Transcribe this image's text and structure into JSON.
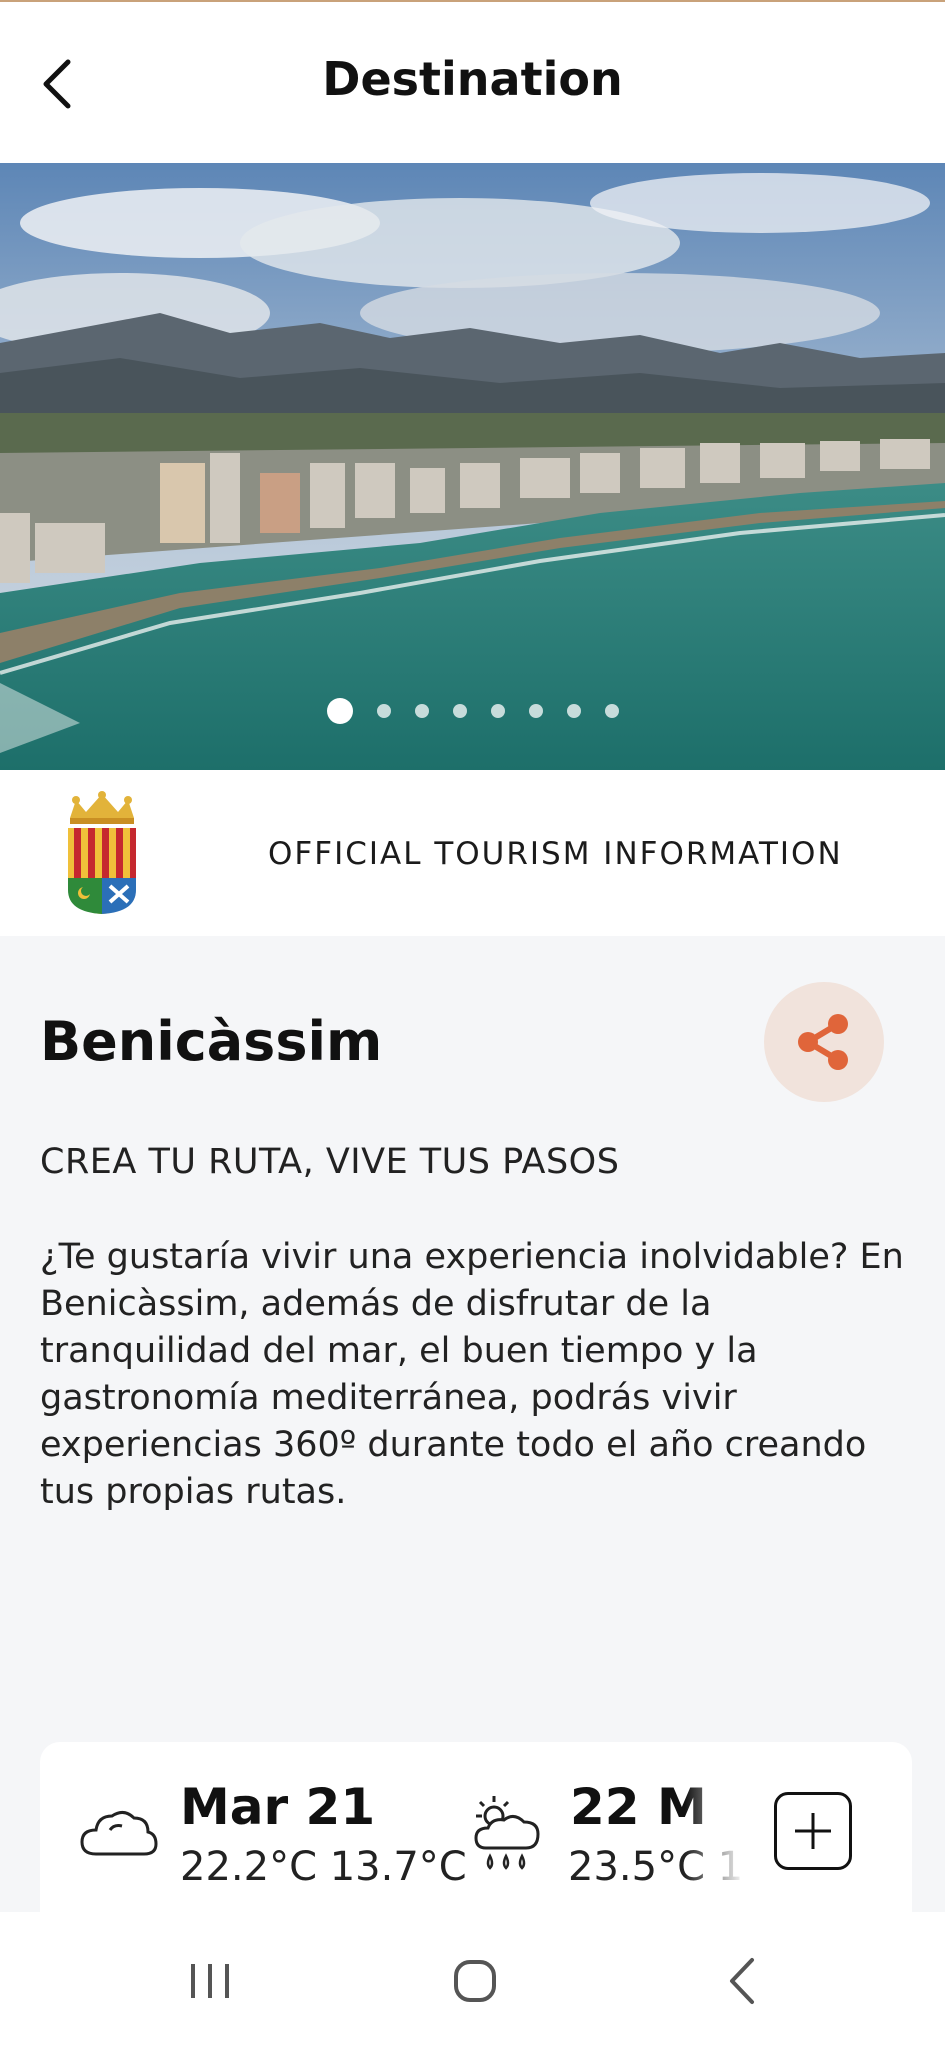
{
  "header": {
    "title": "Destination",
    "back_icon": "chevron-left-icon"
  },
  "carousel": {
    "slide_count": 8,
    "active_index": 0
  },
  "official": {
    "label": "OFFICIAL TOURISM INFORMATION",
    "logo": "benicassim-coat-of-arms"
  },
  "destination": {
    "name": "Benicàssim",
    "share_icon": "share-icon",
    "subtitle": "CREA TU RUTA, VIVE TUS PASOS",
    "description": " ¿Te gustaría vivir una experiencia inolvidable? En Benicàssim, además de disfrutar de la tranquilidad del mar, el buen tiempo y la gastronomía mediterránea, podrás vivir experiencias 360º durante todo el año creando tus propias rutas."
  },
  "weather": {
    "days": [
      {
        "date": "Mar 21",
        "temps": "22.2°C 13.7°C",
        "icon": "cloud-icon"
      },
      {
        "date": "22   M",
        "temps": "23.5°C 1",
        "icon": "sun-cloud-rain-icon"
      }
    ],
    "add_icon": "plus-icon"
  },
  "system_nav": {
    "recent_icon": "recent-apps-icon",
    "home_icon": "home-icon",
    "back_icon": "back-icon"
  },
  "colors": {
    "accent": "#e0653a",
    "share_bg": "#f1e3dc",
    "background": "#f5f6f8"
  }
}
